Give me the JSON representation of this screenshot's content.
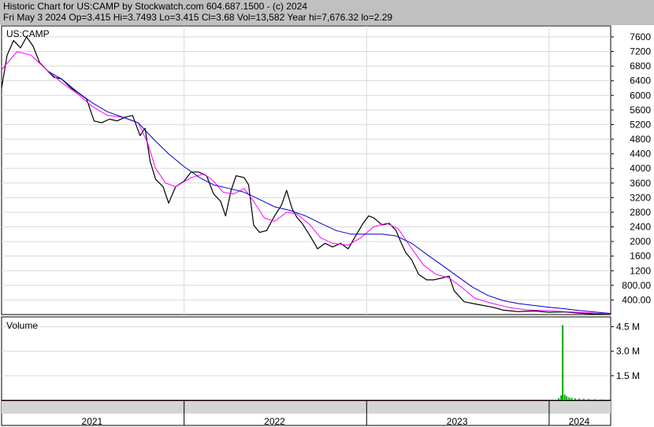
{
  "header": {
    "line1": "Historic Chart for US:CAMP by Stockwatch.com 604.687.1500 - (c) 2024",
    "line2": "Fri May  3 2024  Op=3.415  Hi=3.7493  Lo=3.415  Cl=3.68  Vol=13,582  Year hi=7,676.32  lo=2.29"
  },
  "colors": {
    "price": "#000000",
    "ma_fast": "#ff00ff",
    "ma_slow": "#0000cc",
    "volume": "#00aa00",
    "volume_red": "#cc0000",
    "header_bg": "#c0c0c0",
    "grid": "#d9d9d9"
  },
  "chart_data": [
    {
      "type": "line",
      "title": "US:CAMP",
      "ylim": [
        0,
        7900
      ],
      "yticks": [
        "7600",
        "7200",
        "6800",
        "6400",
        "6000",
        "5600",
        "5200",
        "4800",
        "4400",
        "4000",
        "3600",
        "3200",
        "2800",
        "2400",
        "2000",
        "1600",
        "1200",
        "800.00",
        "400.00"
      ],
      "ytick_values": [
        7600,
        7200,
        6800,
        6400,
        6000,
        5600,
        5200,
        4800,
        4400,
        4000,
        3600,
        3200,
        2800,
        2400,
        2000,
        1600,
        1200,
        800,
        400
      ],
      "xlim": [
        "2021-01-01",
        "2024-05-03"
      ],
      "x_labels": [
        "2021",
        "2022",
        "2023",
        "2024"
      ],
      "x_label_dates": [
        "2021-07-01",
        "2022-07-01",
        "2023-07-01",
        "2024-03-01"
      ],
      "x_boundaries": [
        "2022-01-01",
        "2023-01-01",
        "2024-01-01"
      ],
      "series": [
        {
          "role": "price",
          "points": [
            [
              "2021-01-01",
              6200
            ],
            [
              "2021-01-12",
              7100
            ],
            [
              "2021-01-25",
              7500
            ],
            [
              "2021-02-08",
              7300
            ],
            [
              "2021-02-20",
              7600
            ],
            [
              "2021-03-05",
              7350
            ],
            [
              "2021-03-18",
              6900
            ],
            [
              "2021-04-01",
              6700
            ],
            [
              "2021-04-15",
              6500
            ],
            [
              "2021-05-01",
              6450
            ],
            [
              "2021-05-20",
              6200
            ],
            [
              "2021-06-05",
              6050
            ],
            [
              "2021-06-20",
              5900
            ],
            [
              "2021-07-05",
              5300
            ],
            [
              "2021-07-20",
              5250
            ],
            [
              "2021-08-05",
              5350
            ],
            [
              "2021-08-20",
              5300
            ],
            [
              "2021-09-05",
              5400
            ],
            [
              "2021-09-20",
              5450
            ],
            [
              "2021-10-05",
              4900
            ],
            [
              "2021-10-15",
              5100
            ],
            [
              "2021-10-25",
              4200
            ],
            [
              "2021-11-05",
              3700
            ],
            [
              "2021-11-20",
              3500
            ],
            [
              "2021-12-01",
              3050
            ],
            [
              "2021-12-15",
              3500
            ],
            [
              "2022-01-01",
              3650
            ],
            [
              "2022-01-15",
              3900
            ],
            [
              "2022-01-30",
              3900
            ],
            [
              "2022-02-15",
              3800
            ],
            [
              "2022-03-01",
              3300
            ],
            [
              "2022-03-15",
              3100
            ],
            [
              "2022-03-25",
              2700
            ],
            [
              "2022-04-05",
              3400
            ],
            [
              "2022-04-15",
              3800
            ],
            [
              "2022-05-01",
              3750
            ],
            [
              "2022-05-10",
              3550
            ],
            [
              "2022-05-20",
              2450
            ],
            [
              "2022-06-01",
              2250
            ],
            [
              "2022-06-15",
              2300
            ],
            [
              "2022-07-01",
              2700
            ],
            [
              "2022-07-15",
              3000
            ],
            [
              "2022-07-25",
              3400
            ],
            [
              "2022-08-05",
              2900
            ],
            [
              "2022-08-15",
              2650
            ],
            [
              "2022-08-25",
              2500
            ],
            [
              "2022-09-10",
              2150
            ],
            [
              "2022-09-25",
              1800
            ],
            [
              "2022-10-10",
              1950
            ],
            [
              "2022-10-25",
              1850
            ],
            [
              "2022-11-10",
              1950
            ],
            [
              "2022-11-25",
              1800
            ],
            [
              "2022-12-10",
              2150
            ],
            [
              "2022-12-25",
              2500
            ],
            [
              "2023-01-05",
              2700
            ],
            [
              "2023-01-15",
              2650
            ],
            [
              "2023-02-01",
              2450
            ],
            [
              "2023-02-15",
              2500
            ],
            [
              "2023-03-01",
              2300
            ],
            [
              "2023-03-10",
              2000
            ],
            [
              "2023-03-20",
              1700
            ],
            [
              "2023-04-01",
              1500
            ],
            [
              "2023-04-15",
              1100
            ],
            [
              "2023-05-01",
              950
            ],
            [
              "2023-05-15",
              950
            ],
            [
              "2023-06-01",
              1000
            ],
            [
              "2023-06-15",
              1050
            ],
            [
              "2023-06-25",
              650
            ],
            [
              "2023-07-15",
              350
            ],
            [
              "2023-08-10",
              280
            ],
            [
              "2023-09-10",
              200
            ],
            [
              "2023-10-01",
              120
            ],
            [
              "2023-11-01",
              80
            ],
            [
              "2023-12-01",
              100
            ],
            [
              "2024-01-01",
              60
            ],
            [
              "2024-02-01",
              70
            ],
            [
              "2024-03-01",
              40
            ],
            [
              "2024-04-01",
              15
            ],
            [
              "2024-05-03",
              4
            ]
          ]
        },
        {
          "role": "ma_fast",
          "points": [
            [
              "2021-01-01",
              6700
            ],
            [
              "2021-02-01",
              7200
            ],
            [
              "2021-03-01",
              7100
            ],
            [
              "2021-04-01",
              6700
            ],
            [
              "2021-05-01",
              6350
            ],
            [
              "2021-06-01",
              6050
            ],
            [
              "2021-07-01",
              5700
            ],
            [
              "2021-08-01",
              5450
            ],
            [
              "2021-09-01",
              5400
            ],
            [
              "2021-10-01",
              5250
            ],
            [
              "2021-10-20",
              4700
            ],
            [
              "2021-11-05",
              4000
            ],
            [
              "2021-11-25",
              3600
            ],
            [
              "2021-12-15",
              3500
            ],
            [
              "2022-01-15",
              3750
            ],
            [
              "2022-02-10",
              3850
            ],
            [
              "2022-03-01",
              3650
            ],
            [
              "2022-03-20",
              3350
            ],
            [
              "2022-04-10",
              3300
            ],
            [
              "2022-05-01",
              3450
            ],
            [
              "2022-05-20",
              3100
            ],
            [
              "2022-06-10",
              2650
            ],
            [
              "2022-07-01",
              2550
            ],
            [
              "2022-07-25",
              2800
            ],
            [
              "2022-08-15",
              2750
            ],
            [
              "2022-09-10",
              2450
            ],
            [
              "2022-10-01",
              2100
            ],
            [
              "2022-10-25",
              1950
            ],
            [
              "2022-11-25",
              1900
            ],
            [
              "2022-12-20",
              2100
            ],
            [
              "2023-01-15",
              2400
            ],
            [
              "2023-02-10",
              2500
            ],
            [
              "2023-03-05",
              2350
            ],
            [
              "2023-03-30",
              1850
            ],
            [
              "2023-04-25",
              1350
            ],
            [
              "2023-05-20",
              1100
            ],
            [
              "2023-06-15",
              1000
            ],
            [
              "2023-07-10",
              750
            ],
            [
              "2023-08-05",
              450
            ],
            [
              "2023-09-05",
              320
            ],
            [
              "2023-10-10",
              200
            ],
            [
              "2023-11-15",
              130
            ],
            [
              "2023-12-20",
              110
            ],
            [
              "2024-02-01",
              80
            ],
            [
              "2024-03-15",
              50
            ],
            [
              "2024-05-03",
              20
            ]
          ]
        },
        {
          "role": "ma_slow",
          "points": [
            [
              "2021-04-05",
              6650
            ],
            [
              "2021-05-01",
              6450
            ],
            [
              "2021-06-01",
              6100
            ],
            [
              "2021-07-01",
              5800
            ],
            [
              "2021-08-01",
              5550
            ],
            [
              "2021-09-01",
              5400
            ],
            [
              "2021-10-01",
              5250
            ],
            [
              "2021-11-01",
              4800
            ],
            [
              "2021-12-01",
              4400
            ],
            [
              "2022-01-01",
              4050
            ],
            [
              "2022-02-01",
              3750
            ],
            [
              "2022-03-01",
              3550
            ],
            [
              "2022-04-01",
              3450
            ],
            [
              "2022-05-01",
              3350
            ],
            [
              "2022-06-01",
              3150
            ],
            [
              "2022-07-01",
              2950
            ],
            [
              "2022-08-01",
              2850
            ],
            [
              "2022-09-01",
              2700
            ],
            [
              "2022-10-01",
              2500
            ],
            [
              "2022-11-01",
              2300
            ],
            [
              "2022-12-01",
              2200
            ],
            [
              "2023-01-01",
              2200
            ],
            [
              "2023-02-01",
              2200
            ],
            [
              "2023-03-01",
              2150
            ],
            [
              "2023-04-01",
              1950
            ],
            [
              "2023-05-01",
              1650
            ],
            [
              "2023-06-01",
              1350
            ],
            [
              "2023-07-01",
              1050
            ],
            [
              "2023-08-01",
              750
            ],
            [
              "2023-09-01",
              520
            ],
            [
              "2023-10-01",
              380
            ],
            [
              "2023-11-01",
              300
            ],
            [
              "2023-12-01",
              250
            ],
            [
              "2024-01-01",
              200
            ],
            [
              "2024-02-01",
              160
            ],
            [
              "2024-03-01",
              110
            ],
            [
              "2024-04-01",
              70
            ],
            [
              "2024-05-03",
              30
            ]
          ]
        }
      ]
    },
    {
      "type": "bar",
      "title": "Volume",
      "ylim": [
        0,
        5100000
      ],
      "yticks": [
        "4.5 M",
        "3.0 M",
        "1.5 M"
      ],
      "ytick_values": [
        4500000,
        3000000,
        1500000
      ],
      "baseline": 30000,
      "series": [
        {
          "role": "volume",
          "points": [
            [
              "2024-01-20",
              120000
            ],
            [
              "2024-01-25",
              300000
            ],
            [
              "2024-01-28",
              4600000
            ],
            [
              "2024-02-01",
              350000
            ],
            [
              "2024-02-05",
              250000
            ],
            [
              "2024-02-10",
              180000
            ],
            [
              "2024-02-15",
              140000
            ],
            [
              "2024-02-22",
              120000
            ],
            [
              "2024-03-01",
              100000
            ],
            [
              "2024-03-10",
              90000
            ],
            [
              "2024-03-20",
              80000
            ],
            [
              "2024-04-01",
              70000
            ],
            [
              "2024-04-15",
              60000
            ],
            [
              "2024-05-01",
              50000
            ]
          ]
        }
      ]
    }
  ]
}
